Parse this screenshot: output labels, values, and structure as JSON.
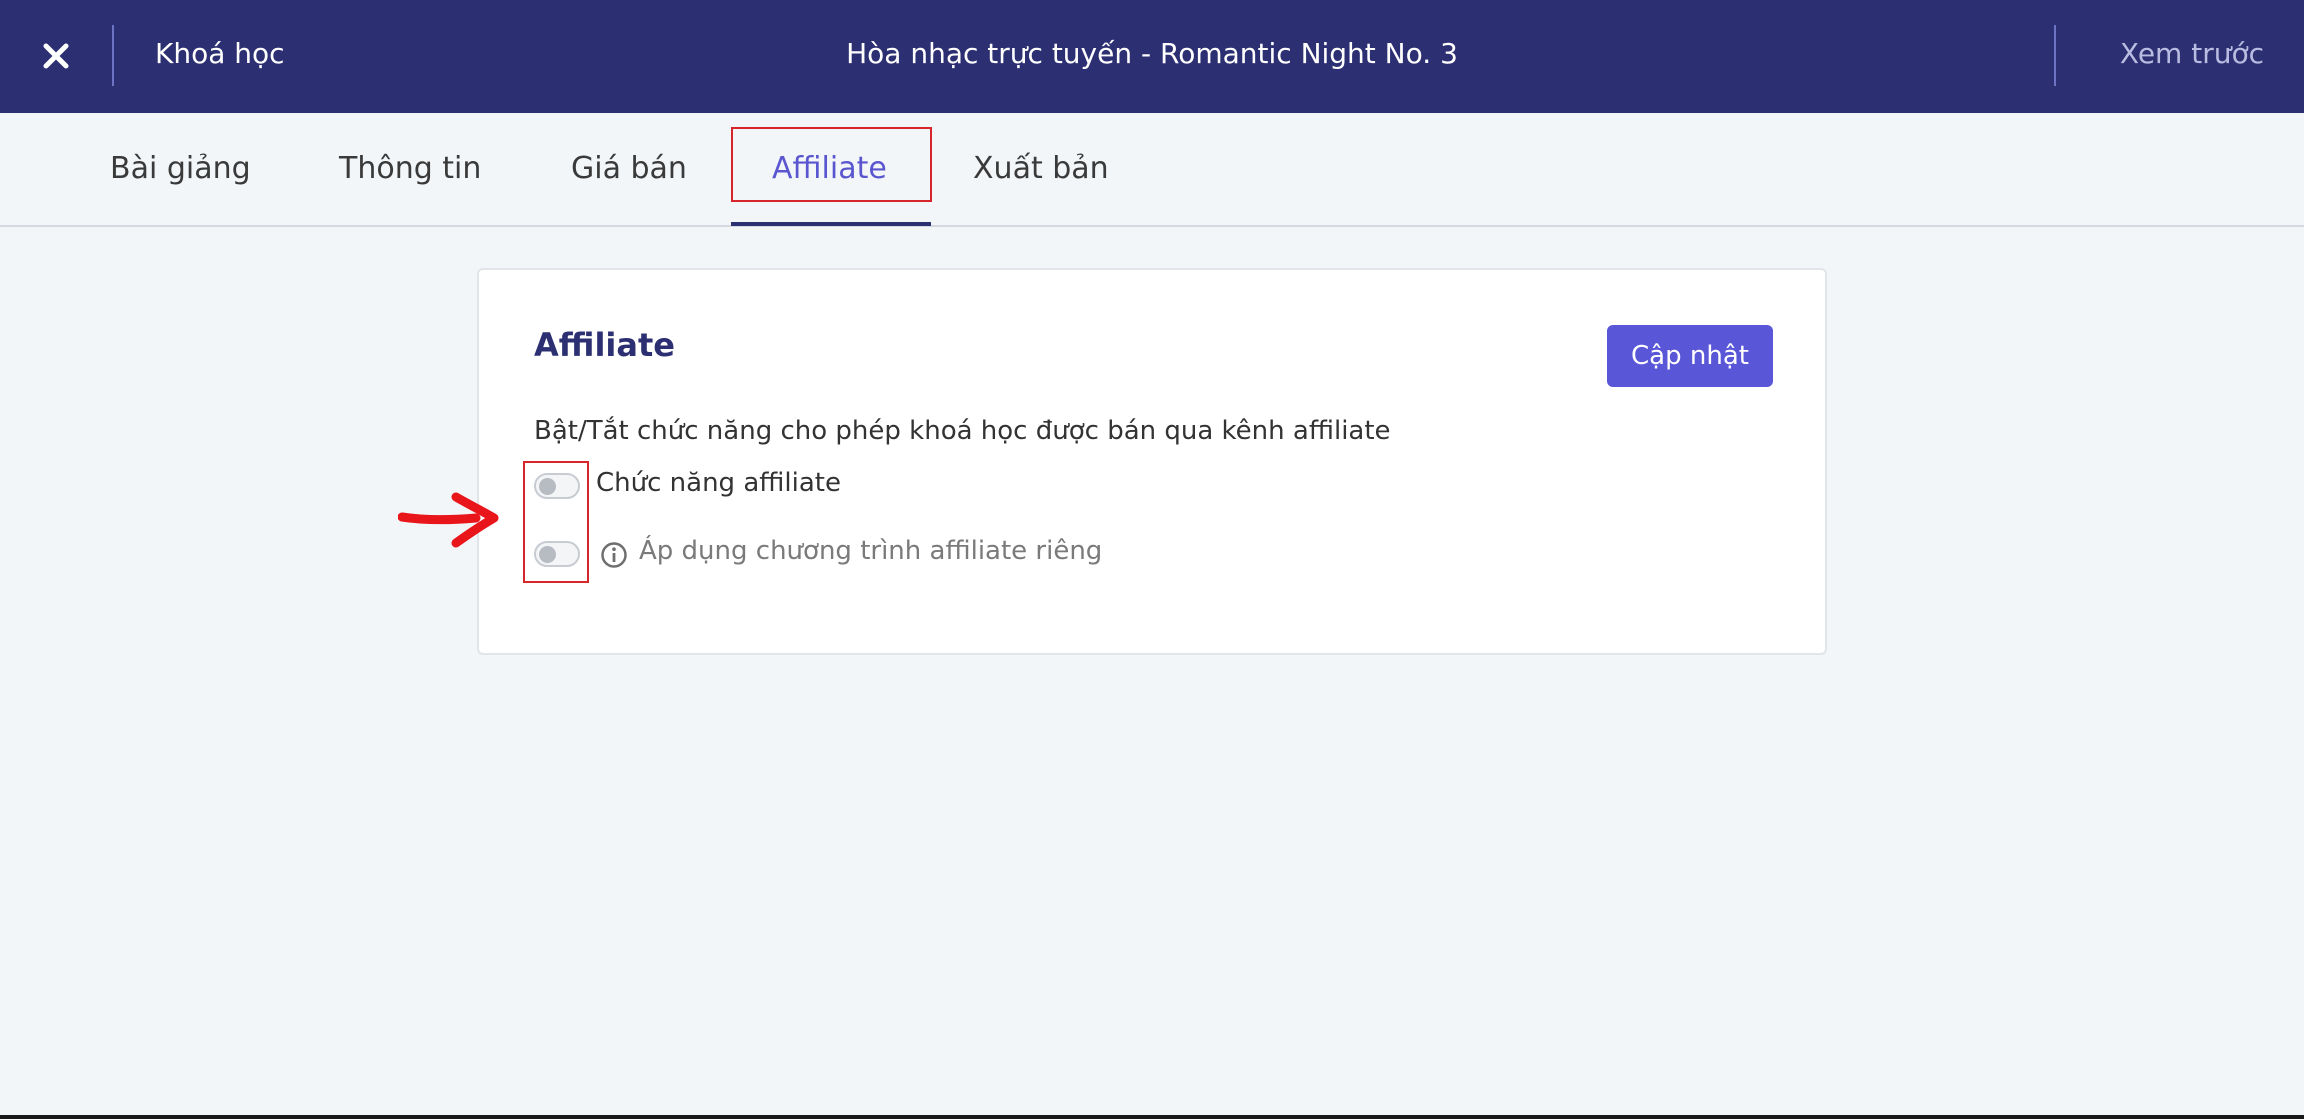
{
  "header": {
    "close_icon": "close-icon",
    "back_label": "Khoá học",
    "title": "Hòa nhạc trực tuyến - Romantic Night No. 3",
    "preview_label": "Xem trước"
  },
  "tabs": [
    {
      "label": "Bài giảng",
      "active": false
    },
    {
      "label": "Thông tin",
      "active": false
    },
    {
      "label": "Giá bán",
      "active": false
    },
    {
      "label": "Affiliate",
      "active": true
    },
    {
      "label": "Xuất bản",
      "active": false
    }
  ],
  "card": {
    "title": "Affiliate",
    "update_label": "Cập nhật",
    "description": "Bật/Tắt chức năng cho phép khoá học được bán qua kênh affiliate",
    "toggles": [
      {
        "label": "Chức năng affiliate",
        "on": false
      },
      {
        "label": "Áp dụng chương trình affiliate riêng",
        "on": false,
        "icon": "info-icon"
      }
    ]
  },
  "colors": {
    "header_bg": "#2c2f72",
    "accent": "#5a56d8",
    "annotation": "#d6262b"
  }
}
